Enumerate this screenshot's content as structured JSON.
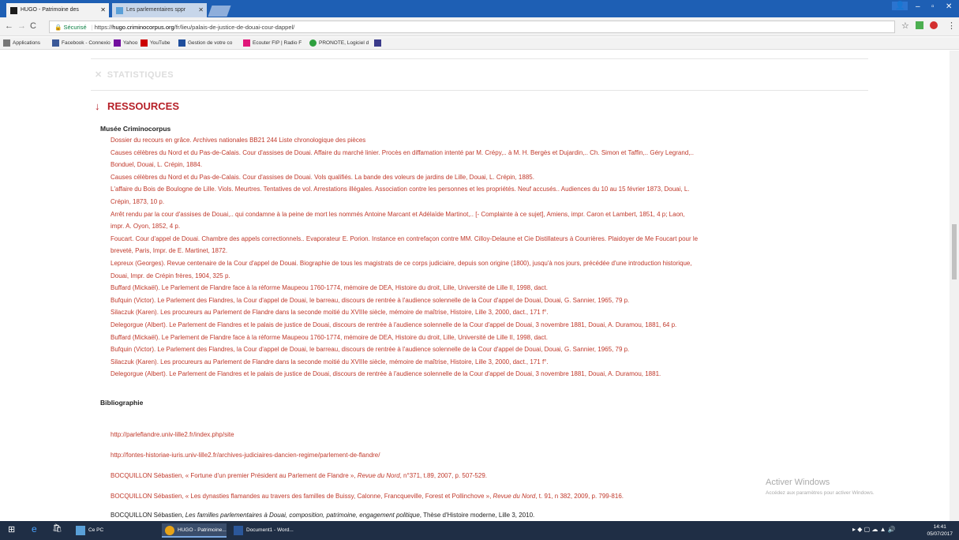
{
  "browser": {
    "tabs": [
      {
        "label": "HUGO - Patrimoine des",
        "active": true
      },
      {
        "label": "Les parlementaires sppr",
        "active": false
      }
    ],
    "address": {
      "secure_label": "Sécurisé",
      "url_prefix": "https://",
      "url_host": "hugo.criminocorpus.org",
      "url_path": "/fr/lieu/palais-de-justice-de-douai-cour-dappel/"
    },
    "bookmarks": [
      {
        "label": "Applications",
        "color": "#777"
      },
      {
        "label": "Facebook - Connexio",
        "color": "#3b5998"
      },
      {
        "label": "Yahoo",
        "color": "#720e9e"
      },
      {
        "label": "YouTube",
        "color": "#cc0000"
      },
      {
        "label": "Gestion de votre co",
        "color": "#1f4e9c"
      },
      {
        "label": "Ecouter FIP | Radio F",
        "color": "#e0177a"
      },
      {
        "label": "PRONOTE, Logiciel d",
        "color": "#2e9f3e"
      },
      {
        "label": "",
        "color": "#3a3a8a"
      }
    ]
  },
  "page": {
    "stat_label": "STATISTIQUES",
    "ressources_label": "RESSOURCES",
    "musee_heading": "Musée Criminocorpus",
    "musee_items": [
      "Dossier du recours en grâce. Archives nationales BB21 244 Liste chronologique des pièces",
      "Causes célèbres du Nord et du Pas-de-Calais. Cour d'assises de Douai. Affaire du marché linier. Procès en diffamation intenté par M. Crépy,.. à M. H. Bergès et Dujardin,.. Ch. Simon et Taffin,.. Géry Legrand,..",
      "Bonduel, Douai, L. Crépin, 1884.",
      "Causes célèbres du Nord et du Pas-de-Calais. Cour d'assises de Douai. Vols qualifiés. La bande des voleurs de jardins de Lille, Douai, L. Crépin, 1885.",
      "L'affaire du Bois de Boulogne de Lille. Viols. Meurtres. Tentatives de vol. Arrestations illégales. Association contre les personnes et les propriétés. Neuf accusés.. Audiences du 10 au 15 février 1873, Douai, L.",
      "Crépin, 1873, 10 p.",
      "Arrêt rendu par la cour d'assises de Douai,.. qui condamne à la peine de mort les nommés Antoine Marcant et Adélaïde Martinot,.. [- Complainte à ce sujet], Amiens, impr. Caron et Lambert, 1851, 4 p; Laon,",
      "impr. A. Oyon, 1852, 4 p.",
      "Foucart. Cour d'appel de Douai. Chambre des appels correctionnels.. Evaporateur E. Porion. Instance en contrefaçon contre MM. Cilloy-Delaune et Cie Distillateurs à Courrières. Plaidoyer de Me Foucart pour le",
      "breveté, Paris, Impr. de E. Martinet, 1872.",
      "Lepreux (Georges). Revue centenaire de la Cour d'appel de Douai. Biographie de tous les magistrats de ce corps judiciaire, depuis son origine (1800), jusqu'à nos jours, précédée d'une introduction historique,",
      "Douai, Impr. de Crépin frères, 1904, 325 p.",
      "Buffard (Mickaël). Le Parlement de Flandre face à la réforme Maupeou 1760-1774, mémoire de DEA, Histoire du droit, Lille, Université de Lille II, 1998, dact.",
      "Bufquin (Victor). Le Parlement des Flandres, la Cour d'appel de Douai, le barreau, discours de rentrée à l'audience solennelle de la Cour d'appel de Douai, Douai, G. Sannier, 1965, 79 p.",
      "Silaczuk (Karen). Les procureurs au Parlement de Flandre dans la seconde moitié du XVIIIe siècle, mémoire de maîtrise, Histoire, Lille 3, 2000, dact., 171 f°.",
      "Delegorgue (Albert). Le Parlement de Flandres et le palais de justice de Douai, discours de rentrée à l'audience solennelle de la Cour d'appel de Douai, 3 novembre 1881, Douai, A. Duramou, 1881, 64 p.",
      "Buffard (Mickaël). Le Parlement de Flandre face à la réforme Maupeou 1760-1774, mémoire de DEA, Histoire du droit, Lille, Université de Lille II, 1998, dact.",
      "Bufquin (Victor). Le Parlement des Flandres, la Cour d'appel de Douai, le barreau, discours de rentrée à l'audience solennelle de la Cour d'appel de Douai, Douai, G. Sannier, 1965, 79 p.",
      "Silaczuk (Karen). Les procureurs au Parlement de Flandre dans la seconde moitié du XVIIIe siècle, mémoire de maîtrise, Histoire, Lille 3, 2000, dact., 171 f°.",
      "Delegorgue (Albert). Le Parlement de Flandres et le palais de justice de Douai, discours de rentrée à l'audience solennelle de la Cour d'appel de Douai, 3 novembre 1881, Douai, A. Duramou, 1881."
    ],
    "biblio_heading": "Bibliographie",
    "biblio_links": [
      "http://parleflandre.univ-lille2.fr/index.php/site",
      "http://fontes-historiae-iuris.univ-lille2.fr/archives-judiciaires-dancien-regime/parlement-de-flandre/"
    ],
    "biblio_refs": [
      {
        "before": "BOCQUILLON Sébastien, « Fortune d'un premier Président au Parlement de Flandre », ",
        "italic": "Revue du Nord",
        "after": ", n°371, t.89, 2007, p. 507-529."
      },
      {
        "before": "BOCQUILLON Sébastien, « Les dynasties flamandes au travers des familles de Buissy, Calonne, Francqueville, Forest et Pollinchove », ",
        "italic": "Revue du Nord",
        "after": ", t. 91, n 382, 2009, p. 799-816."
      },
      {
        "before": "BOCQUILLON Sébastien, ",
        "italic": "Les familles parlementaires à Douai, composition, patrimoine, engagement politique",
        "after": ", Thèse d'Histoire moderne, Lille 3, 2010."
      }
    ],
    "watermark_title": "Activer Windows",
    "watermark_sub": "Accédez aux paramètres pour activer Windows."
  },
  "taskbar": {
    "items": [
      {
        "label": "Ce PC",
        "active": false
      },
      {
        "label": "HUGO - Patrimoine...",
        "active": true
      },
      {
        "label": "Document1 - Word...",
        "active": false
      }
    ],
    "time": "14:41",
    "date": "05/07/2017"
  }
}
